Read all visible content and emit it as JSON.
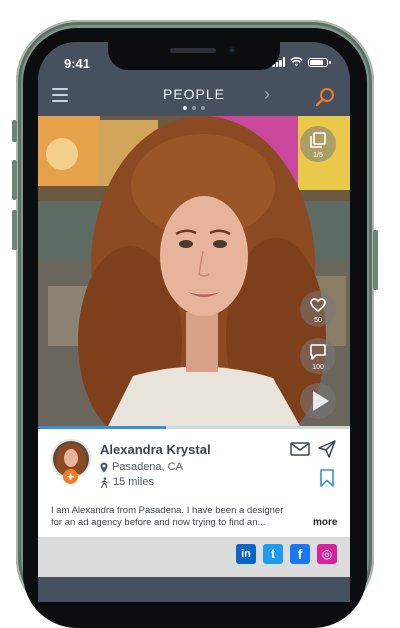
{
  "status_bar": {
    "time": "9:41",
    "battery_level": 0.85
  },
  "nav": {
    "title": "PEOPLE",
    "next_arrow": "›",
    "page_count": 3,
    "active_page": 0
  },
  "photo_actions": {
    "gallery": {
      "icon": "gallery-icon",
      "count": "1/5"
    },
    "like": {
      "icon": "heart-icon",
      "count": "50"
    },
    "comment": {
      "icon": "comment-icon",
      "count": "100"
    },
    "play": {
      "icon": "play-icon"
    }
  },
  "photo_progress": 0.41,
  "profile": {
    "name": "Alexandra Krystal",
    "location": "Pasadena, CA",
    "distance": "15 miles",
    "add_badge": "+",
    "bio": "I am Alexandra from Pasadena. I have been a designer for an ad agency before and now trying to find an...",
    "more_label": "more"
  },
  "social_links": [
    {
      "name": "LinkedIn",
      "label": "in",
      "color": "#0a66c2"
    },
    {
      "name": "Twitter",
      "label": "t",
      "color": "#1d9bf0"
    },
    {
      "name": "Facebook",
      "label": "f",
      "color": "#1877f2"
    },
    {
      "name": "Instagram",
      "label": "◎",
      "color": "#d6249f"
    }
  ],
  "colors": {
    "accent": "#f07c2b",
    "nav_background": "#46505e",
    "progress": "#3b8fd9"
  }
}
